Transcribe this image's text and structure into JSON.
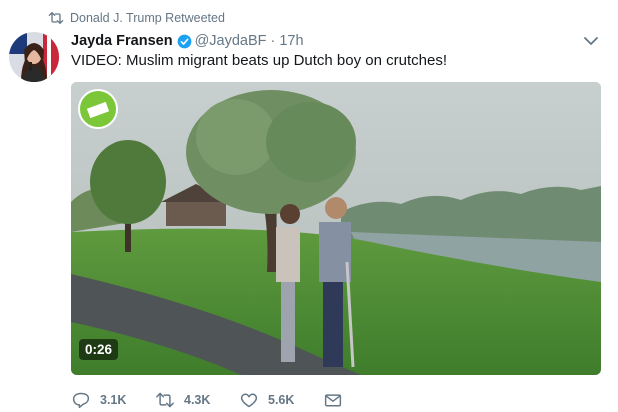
{
  "context": {
    "retweeted_by": "Donald J. Trump Retweeted"
  },
  "author": {
    "name": "Jayda Fransen",
    "handle": "@JaydaBF",
    "separator": "·",
    "time": "17h",
    "verified": true
  },
  "tweet": {
    "text": "VIDEO: Muslim migrant beats up Dutch boy on crutches!"
  },
  "media": {
    "type": "video",
    "duration": "0:26"
  },
  "actions": {
    "reply_count": "3.1K",
    "retweet_count": "4.3K",
    "like_count": "5.6K"
  },
  "icons": {
    "retweet": "retweet-icon",
    "verified": "verified-badge-icon",
    "caret": "chevron-down-icon",
    "reply": "reply-icon",
    "like": "heart-icon",
    "dm": "envelope-icon"
  },
  "colors": {
    "text": "#14171a",
    "secondary": "#657786",
    "verified": "#1da1f2"
  }
}
